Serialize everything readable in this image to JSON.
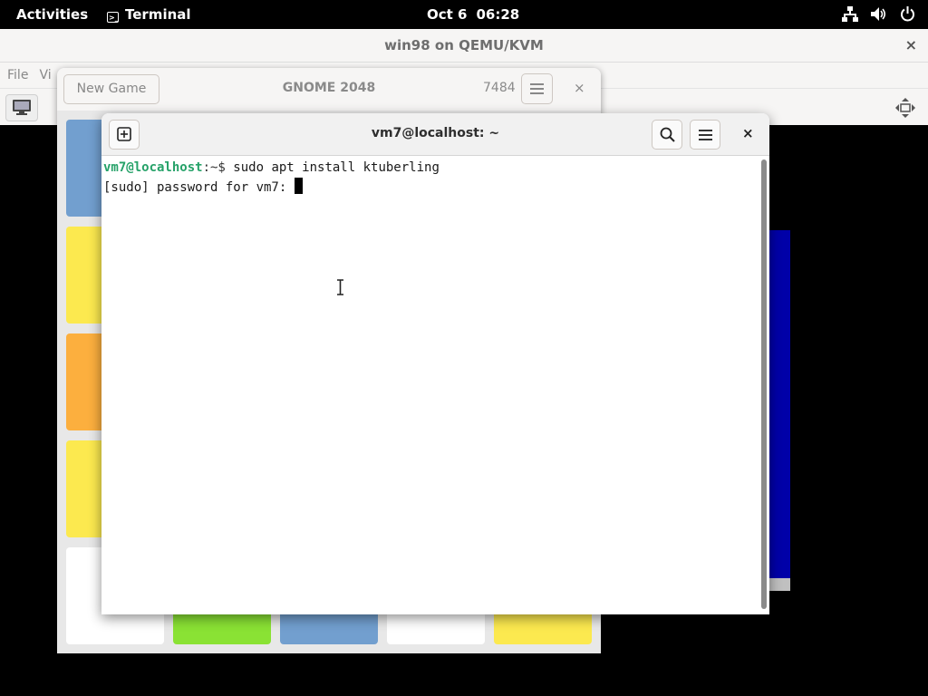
{
  "topbar": {
    "activities": "Activities",
    "app_name": "Terminal",
    "date": "Oct 6",
    "time": "06:28",
    "tray_icons": [
      "network-icon",
      "volume-icon",
      "power-icon"
    ]
  },
  "vm_window": {
    "title": "win98 on QEMU/KVM",
    "menu": [
      "File",
      "Vi"
    ],
    "close_label": "×"
  },
  "game_window": {
    "new_game_label": "New Game",
    "title": "GNOME 2048",
    "score": "7484",
    "close_label": "×",
    "tile_colors": [
      "#729fcf",
      "#fce94f",
      "#fcaf3e",
      "#fce94f",
      "#ffffff",
      "#8ae234",
      "#729fcf",
      "#ffffff",
      "#fce94f"
    ]
  },
  "terminal": {
    "title": "vm7@localhost: ~",
    "close_label": "×",
    "prompt_user": "vm7@localhost",
    "prompt_path": ":~$ ",
    "command": "sudo apt install ktuberling",
    "password_prompt": "[sudo] password for vm7: "
  },
  "colors": {
    "prompt_green": "#26a269",
    "vm_blue": "#0000a8"
  }
}
